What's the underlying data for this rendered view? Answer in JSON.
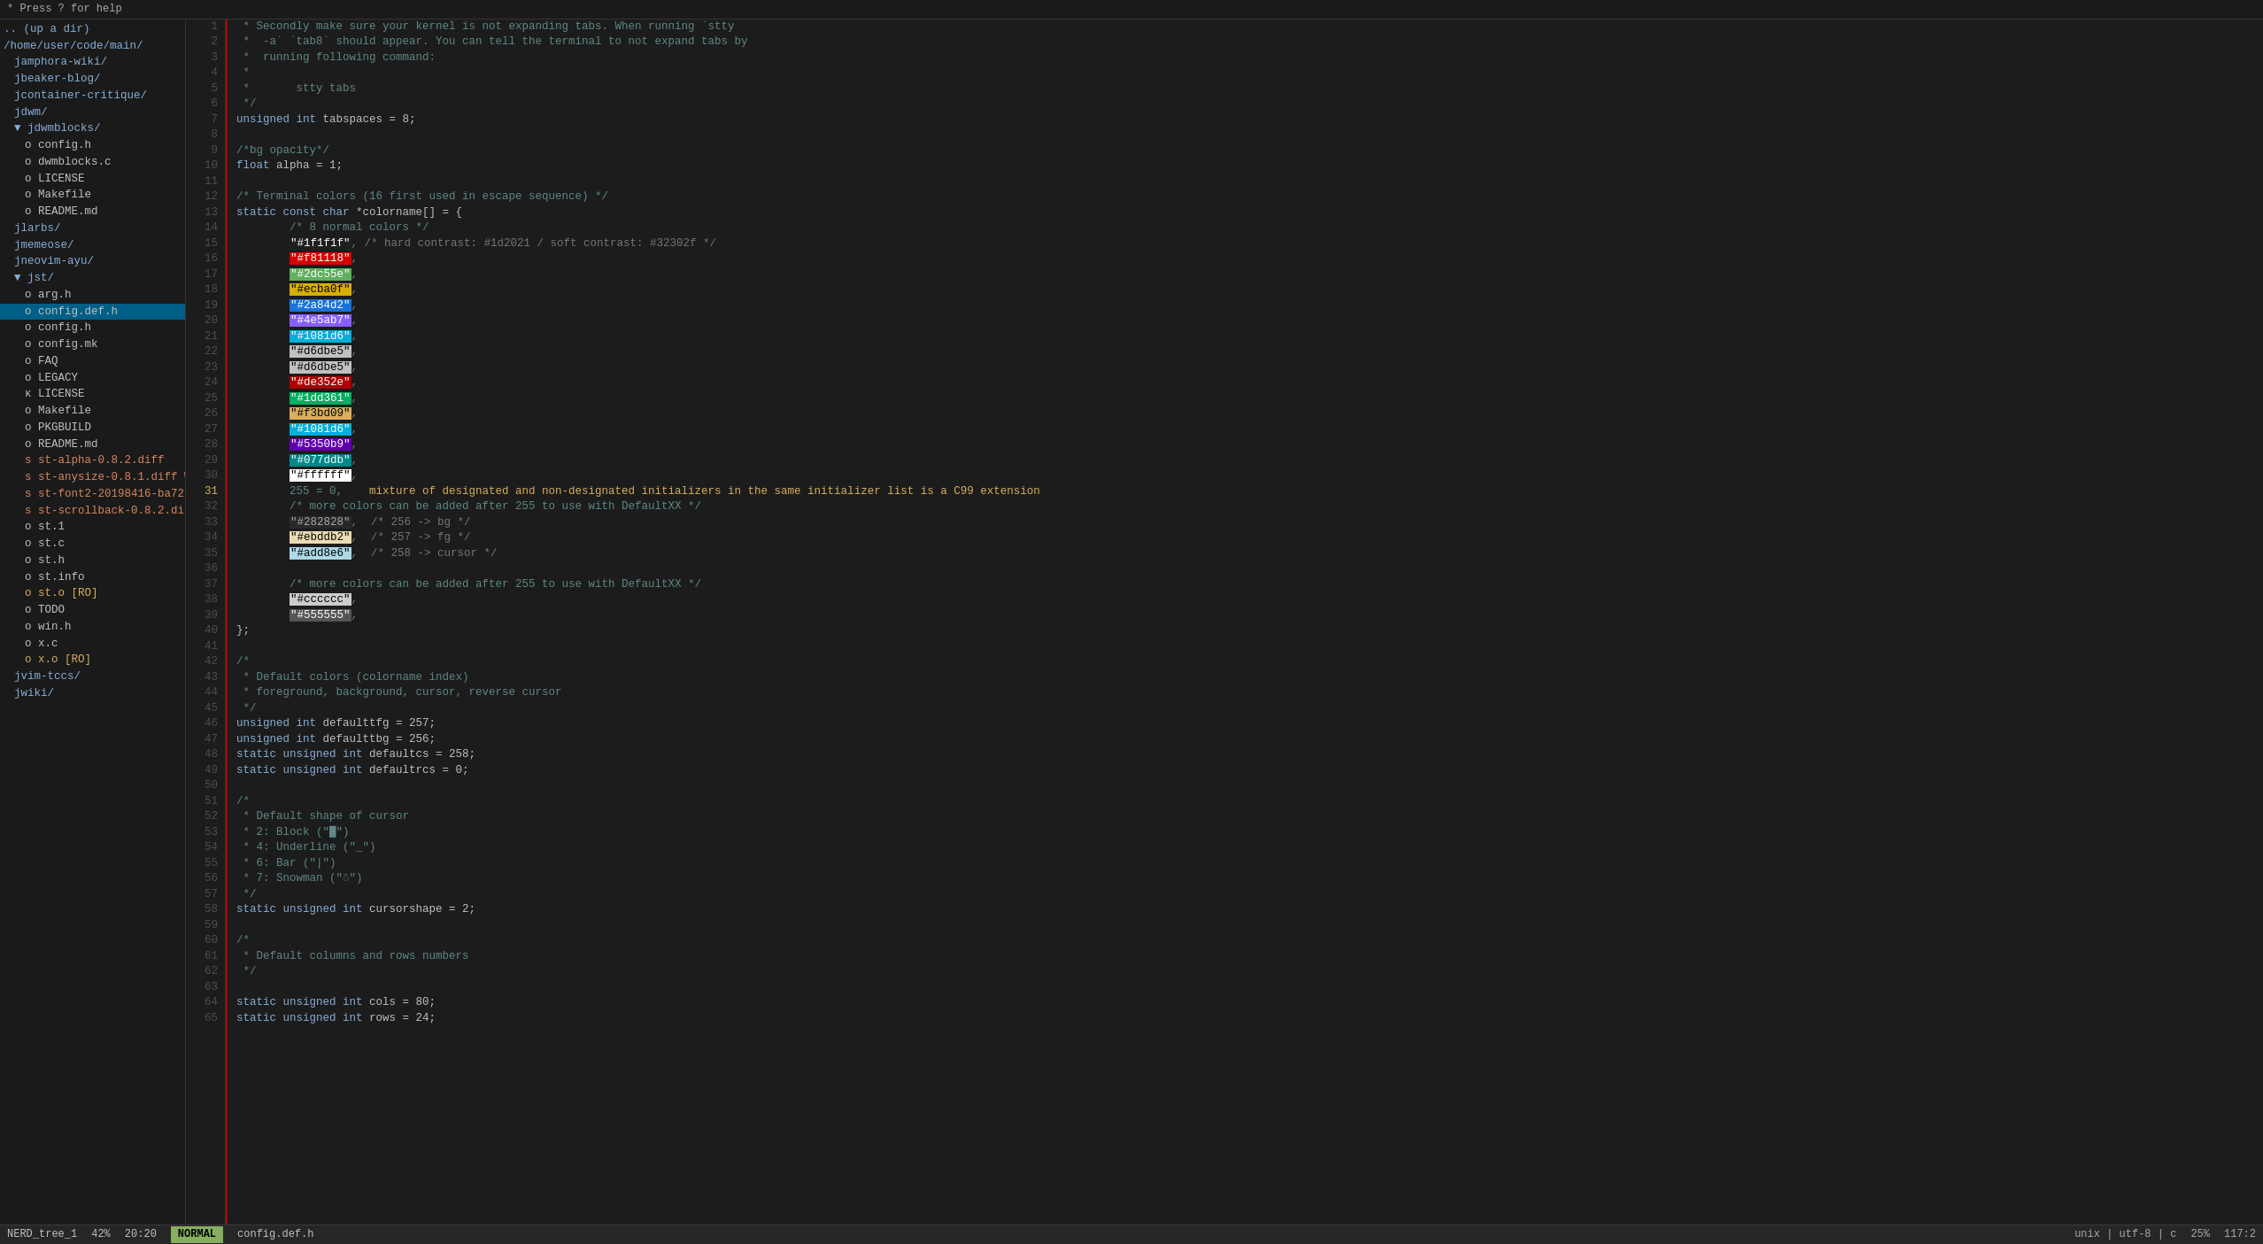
{
  "topbar": {
    "text": "* Press ? for help"
  },
  "sidebar": {
    "items": [
      {
        "id": "up",
        "label": ".. (up a dir)",
        "indent": 0,
        "type": "dir"
      },
      {
        "id": "home-path",
        "label": "/home/user/code/main/",
        "indent": 0,
        "type": "path"
      },
      {
        "id": "amphora-wiki",
        "label": "jamphora-wiki/",
        "indent": 1,
        "type": "dir"
      },
      {
        "id": "beaker-blog",
        "label": "jbeaker-blog/",
        "indent": 1,
        "type": "dir"
      },
      {
        "id": "container-critique",
        "label": "jcontainer-critique/",
        "indent": 1,
        "type": "dir"
      },
      {
        "id": "dwm",
        "label": "jdwm/",
        "indent": 1,
        "type": "dir"
      },
      {
        "id": "dwmblocks",
        "label": "▼ jdwmblocks/",
        "indent": 1,
        "type": "dir-open"
      },
      {
        "id": "config-h",
        "label": "o config.h",
        "indent": 2,
        "type": "file"
      },
      {
        "id": "config-blocks-c",
        "label": "o dwmblocks.c",
        "indent": 2,
        "type": "file"
      },
      {
        "id": "license",
        "label": "o LICENSE",
        "indent": 2,
        "type": "file"
      },
      {
        "id": "makefile",
        "label": "o Makefile",
        "indent": 2,
        "type": "file"
      },
      {
        "id": "readme-md",
        "label": "o README.md",
        "indent": 2,
        "type": "file"
      },
      {
        "id": "larbs",
        "label": "jlarbs/",
        "indent": 1,
        "type": "dir"
      },
      {
        "id": "memeose",
        "label": "jmemeose/",
        "indent": 1,
        "type": "dir"
      },
      {
        "id": "neovim-ayu",
        "label": "jneovim-ayu/",
        "indent": 1,
        "type": "dir"
      },
      {
        "id": "lst",
        "label": "▼ jst/",
        "indent": 1,
        "type": "dir-open"
      },
      {
        "id": "arg-h",
        "label": "o arg.h",
        "indent": 2,
        "type": "file"
      },
      {
        "id": "config-def-h",
        "label": "o config.def.h",
        "indent": 2,
        "type": "file",
        "active": true
      },
      {
        "id": "config-h2",
        "label": "o config.h",
        "indent": 2,
        "type": "file"
      },
      {
        "id": "config-mk",
        "label": "o config.mk",
        "indent": 2,
        "type": "file"
      },
      {
        "id": "faq",
        "label": "o FAQ",
        "indent": 2,
        "type": "file"
      },
      {
        "id": "legacy",
        "label": "o LEGACY",
        "indent": 2,
        "type": "file"
      },
      {
        "id": "license2",
        "label": "κ LICENSE",
        "indent": 2,
        "type": "file"
      },
      {
        "id": "makefile2",
        "label": "o Makefile",
        "indent": 2,
        "type": "file"
      },
      {
        "id": "pkgbuild",
        "label": "o PKGBUILD",
        "indent": 2,
        "type": "file"
      },
      {
        "id": "readme2",
        "label": "o README.md",
        "indent": 2,
        "type": "file"
      },
      {
        "id": "st-alpha-diff",
        "label": "s st-alpha-0.8.2.diff",
        "indent": 2,
        "type": "diff"
      },
      {
        "id": "st-anysize-diff",
        "label": "s st-anysize-0.8.1.diff",
        "indent": 2,
        "type": "diff",
        "modified": true
      },
      {
        "id": "st-font2",
        "label": "s st-font2-20198416-ba72",
        "indent": 2,
        "type": "diff"
      },
      {
        "id": "st-scrollback-diff",
        "label": "s st-scrollback-0.8.2.di",
        "indent": 2,
        "type": "diff"
      },
      {
        "id": "st1",
        "label": "o st.1",
        "indent": 2,
        "type": "file"
      },
      {
        "id": "st-c",
        "label": "o st.c",
        "indent": 2,
        "type": "file"
      },
      {
        "id": "st-h",
        "label": "o st.h",
        "indent": 2,
        "type": "file"
      },
      {
        "id": "st-info",
        "label": "o st.info",
        "indent": 2,
        "type": "file"
      },
      {
        "id": "st-o",
        "label": "o st.o [RO]",
        "indent": 2,
        "type": "obj"
      },
      {
        "id": "todo",
        "label": "o TODO",
        "indent": 2,
        "type": "file"
      },
      {
        "id": "win-h",
        "label": "o win.h",
        "indent": 2,
        "type": "file"
      },
      {
        "id": "x-c",
        "label": "o x.c",
        "indent": 2,
        "type": "file"
      },
      {
        "id": "x-o",
        "label": "o x.o [RO]",
        "indent": 2,
        "type": "obj"
      },
      {
        "id": "vim-tccs",
        "label": "jvim-tccs/",
        "indent": 1,
        "type": "dir"
      },
      {
        "id": "wiki",
        "label": "jwiki/",
        "indent": 1,
        "type": "dir"
      }
    ]
  },
  "editor": {
    "filename": "config.def.h",
    "mode": "NORMAL",
    "encoding": "unix | utf-8 | c",
    "scroll_pct": "25%",
    "cursor_pos": "117:2",
    "line": "20:20"
  },
  "statusbar": {
    "tree_label": "NERD_tree_1",
    "pct": "42%",
    "pos": "20:20",
    "mode": "NORMAL",
    "filename": "config.def.h",
    "info": "unix | utf-8 | c",
    "scroll": "25%",
    "col": "117:2"
  },
  "code": {
    "lines": [
      {
        "n": 1,
        "text": " * Secondly make sure your kernel is not expanding tabs. When running `stty"
      },
      {
        "n": 2,
        "text": " *  -a` `tab8` should appear. You can tell the terminal to not expand tabs by"
      },
      {
        "n": 3,
        "text": " *  running following command:"
      },
      {
        "n": 4,
        "text": " *"
      },
      {
        "n": 5,
        "text": " *       stty tabs"
      },
      {
        "n": 6,
        "text": " */"
      },
      {
        "n": 7,
        "text": "unsigned int tabspaces = 8;"
      },
      {
        "n": 8,
        "text": ""
      },
      {
        "n": 9,
        "text": "/*bg opacity*/"
      },
      {
        "n": 10,
        "text": "float alpha = 1;"
      },
      {
        "n": 11,
        "text": ""
      },
      {
        "n": 12,
        "text": "/* Terminal colors (16 first used in escape sequence) */"
      },
      {
        "n": 13,
        "text": "static const char *colorname[] = {"
      },
      {
        "n": 14,
        "text": "        /* 8 normal colors */"
      },
      {
        "n": 15,
        "text": "        \"#1f1f1f\", /* hard contrast: #1d2021 / soft contrast: #32302f */"
      },
      {
        "n": 16,
        "text": "        \"#f81118\","
      },
      {
        "n": 17,
        "text": "        \"#2dc55e\","
      },
      {
        "n": 18,
        "text": "        \"#ecba0f\","
      },
      {
        "n": 19,
        "text": "        \"#2a84d2\","
      },
      {
        "n": 20,
        "text": "        \"#4e5ab7\","
      },
      {
        "n": 21,
        "text": "        \"#1081d6\","
      },
      {
        "n": 22,
        "text": "        \"#d6dbe5\","
      },
      {
        "n": 23,
        "text": "        \"#d6dbe5\","
      },
      {
        "n": 24,
        "text": "        \"#de352e\","
      },
      {
        "n": 25,
        "text": "        \"#1dd361\","
      },
      {
        "n": 26,
        "text": "        \"#f3bd09\","
      },
      {
        "n": 27,
        "text": "        \"#1081d6\","
      },
      {
        "n": 28,
        "text": "        \"#5350b9\","
      },
      {
        "n": 29,
        "text": "        \"#077ddb\","
      },
      {
        "n": 30,
        "text": "        \"#ffffff\","
      },
      {
        "n": 31,
        "text": "        255 = 0,    mixture of designated and non-designated initializers in the same initializer list is a C99 extension"
      },
      {
        "n": 32,
        "text": "        /* more colors can be added after 255 to use with DefaultXX */"
      },
      {
        "n": 33,
        "text": "        \"#282828\",  /* 256 -> bg */"
      },
      {
        "n": 34,
        "text": "        \"#ebddb2\",  /* 257 -> fg */"
      },
      {
        "n": 35,
        "text": "        \"#add8e6\",  /* 258 -> cursor */"
      },
      {
        "n": 36,
        "text": ""
      },
      {
        "n": 37,
        "text": "        /* more colors can be added after 255 to use with DefaultXX */"
      },
      {
        "n": 38,
        "text": "        \"#cccccc\","
      },
      {
        "n": 39,
        "text": "        \"#555555\","
      },
      {
        "n": 40,
        "text": "};"
      },
      {
        "n": 41,
        "text": ""
      },
      {
        "n": 42,
        "text": "/*"
      },
      {
        "n": 43,
        "text": " * Default colors (colorname index)"
      },
      {
        "n": 44,
        "text": " * foreground, background, cursor, reverse cursor"
      },
      {
        "n": 45,
        "text": " */"
      },
      {
        "n": 46,
        "text": "unsigned int defaulttfg = 257;"
      },
      {
        "n": 47,
        "text": "unsigned int defaulttbg = 256;"
      },
      {
        "n": 48,
        "text": "static unsigned int defaultcs = 258;"
      },
      {
        "n": 49,
        "text": "static unsigned int defaultrcs = 0;"
      },
      {
        "n": 50,
        "text": ""
      },
      {
        "n": 51,
        "text": "/*"
      },
      {
        "n": 52,
        "text": " * Default shape of cursor"
      },
      {
        "n": 53,
        "text": " * 2: Block (\"█\")"
      },
      {
        "n": 54,
        "text": " * 4: Underline (\"_\")"
      },
      {
        "n": 55,
        "text": " * 6: Bar (\"|\")"
      },
      {
        "n": 56,
        "text": " * 7: Snowman (\"☃\")"
      },
      {
        "n": 57,
        "text": " */"
      },
      {
        "n": 58,
        "text": "static unsigned int cursorshape = 2;"
      },
      {
        "n": 59,
        "text": ""
      },
      {
        "n": 60,
        "text": "/*"
      },
      {
        "n": 61,
        "text": " * Default columns and rows numbers"
      },
      {
        "n": 62,
        "text": " */"
      },
      {
        "n": 63,
        "text": ""
      },
      {
        "n": 64,
        "text": "static unsigned int cols = 80;"
      },
      {
        "n": 65,
        "text": "static unsigned int rows = 24;"
      }
    ]
  }
}
